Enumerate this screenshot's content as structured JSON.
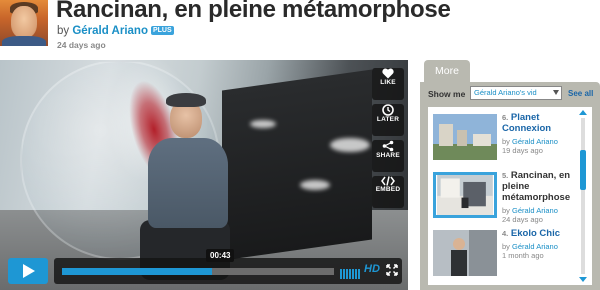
{
  "video": {
    "title": "Rancinan, en pleine métamorphose",
    "by_prefix": "by ",
    "author": "Gérald Ariano",
    "badge": "PLUS",
    "time_ago": "24 days ago"
  },
  "player": {
    "side_controls": [
      {
        "label": "LIKE",
        "icon": "heart-icon"
      },
      {
        "label": "LATER",
        "icon": "clock-icon"
      },
      {
        "label": "SHARE",
        "icon": "share-icon"
      },
      {
        "label": "EMBED",
        "icon": "embed-icon"
      }
    ],
    "current_time": "00:43",
    "progress": 0.55,
    "hd_label": "HD",
    "colors": {
      "accent": "#1e97d4"
    }
  },
  "sidebar": {
    "tab_label": "More",
    "show_me_label": "Show me",
    "select_value": "Gérald Ariano's vid",
    "see_all": "See all",
    "items": [
      {
        "num": "6.",
        "title": "Planet Connexion",
        "by": "by ",
        "author": "Gérald Ariano",
        "time": "19 days ago"
      },
      {
        "num": "5.",
        "title": "Rancinan, en pleine métamorphose",
        "by": "by ",
        "author": "Gérald Ariano",
        "time": "24 days ago"
      },
      {
        "num": "4.",
        "title": "Ekolo Chic",
        "by": "by ",
        "author": "Gérald Ariano",
        "time": "1 month ago"
      }
    ]
  }
}
